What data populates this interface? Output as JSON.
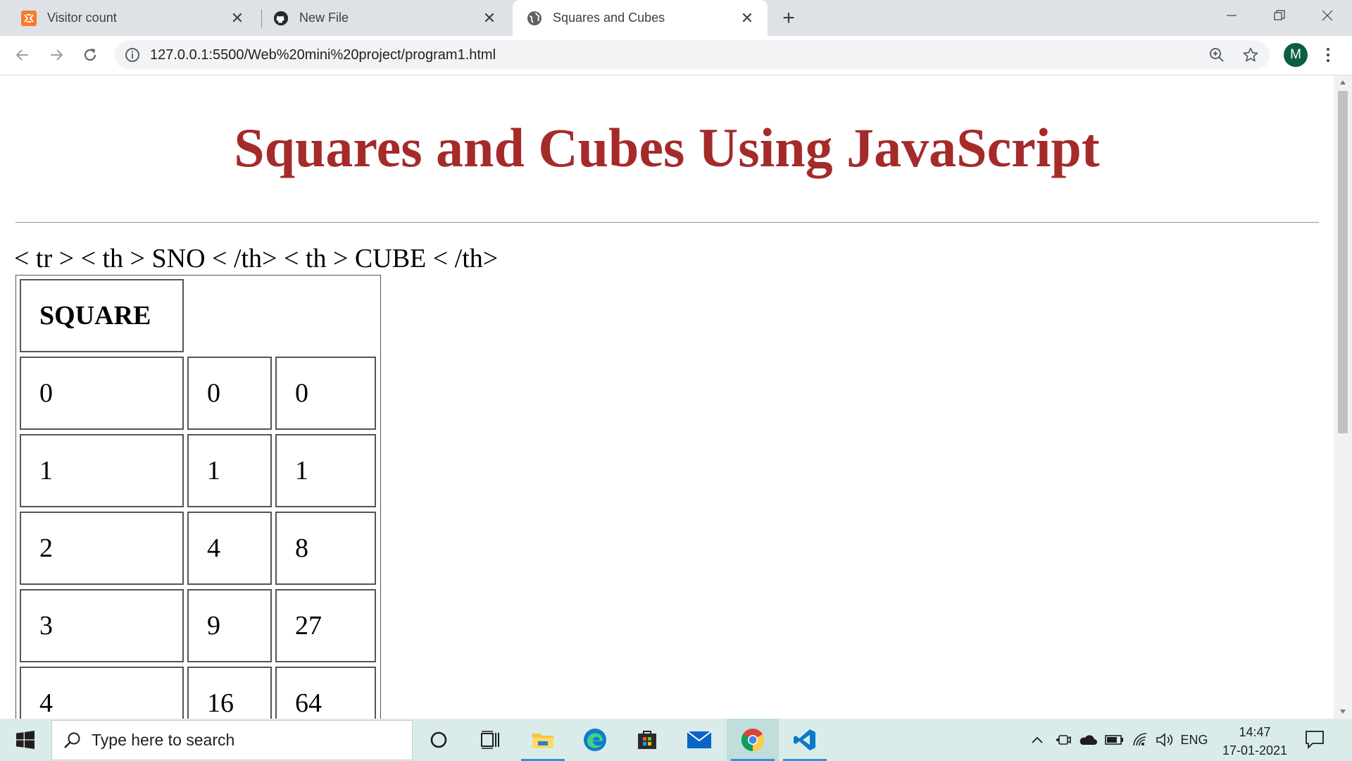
{
  "browser": {
    "tabs": [
      {
        "title": "Visitor count",
        "icon": "xampp-icon",
        "active": false
      },
      {
        "title": "New File",
        "icon": "github-icon",
        "active": false
      },
      {
        "title": "Squares and Cubes",
        "icon": "globe-icon",
        "active": true
      }
    ],
    "url": "127.0.0.1:5500/Web%20mini%20project/program1.html",
    "profile_initial": "M"
  },
  "page": {
    "title": "Squares and Cubes Using JavaScript",
    "stray_text": "< tr > < th > SNO < /th> < th > CUBE < /th>",
    "table": {
      "header": "SQUARE",
      "rows": [
        [
          "0",
          "0",
          "0"
        ],
        [
          "1",
          "1",
          "1"
        ],
        [
          "2",
          "4",
          "8"
        ],
        [
          "3",
          "9",
          "27"
        ],
        [
          "4",
          "16",
          "64"
        ]
      ]
    },
    "title_color": "#a52a2a"
  },
  "taskbar": {
    "search_placeholder": "Type here to search",
    "language": "ENG",
    "time": "14:47",
    "date": "17-01-2021"
  }
}
